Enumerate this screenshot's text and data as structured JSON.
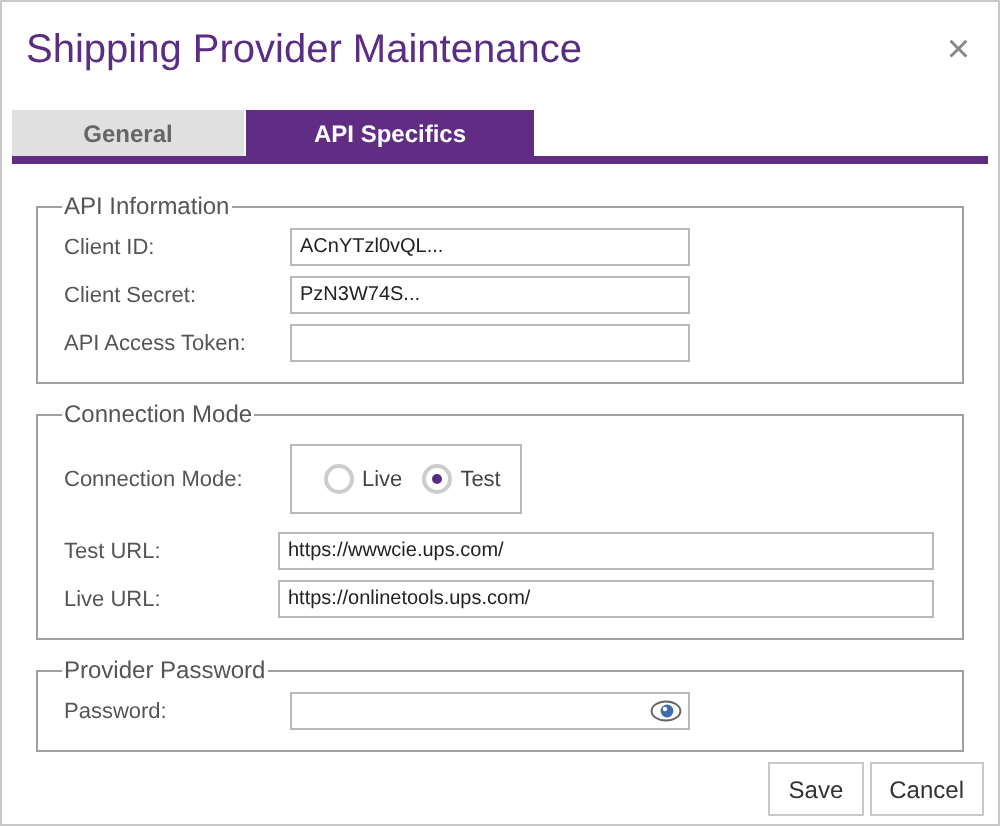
{
  "window": {
    "title": "Shipping Provider Maintenance",
    "close": "×"
  },
  "tabs": [
    {
      "label": "General",
      "selected": false
    },
    {
      "label": "API Specifics",
      "selected": true
    }
  ],
  "sections": [
    {
      "legend": "API Information",
      "rows": [
        {
          "kind": "text",
          "label": "Client ID:",
          "value": "ACnYTzl0vQL..."
        },
        {
          "kind": "text",
          "label": "Client Secret:",
          "value": "PzN3W74S..."
        },
        {
          "kind": "text",
          "label": "API Access Token:"
        }
      ]
    },
    {
      "legend": "Connection Mode",
      "rows": [
        {
          "kind": "radio",
          "label": "Connection Mode:",
          "options": [
            {
              "label": "Live",
              "selected": false
            },
            {
              "label": "Test",
              "selected": true
            }
          ]
        },
        {
          "kind": "url",
          "label": "Test URL:",
          "value": "https://wwwcie.ups.com/"
        },
        {
          "kind": "url",
          "label": "Live URL:",
          "value": "https://onlinetools.ups.com/"
        }
      ]
    },
    {
      "legend": "Provider Password",
      "rows": [
        {
          "kind": "password",
          "label": "Password:"
        }
      ]
    }
  ],
  "buttons": [
    "Save",
    "Cancel"
  ]
}
